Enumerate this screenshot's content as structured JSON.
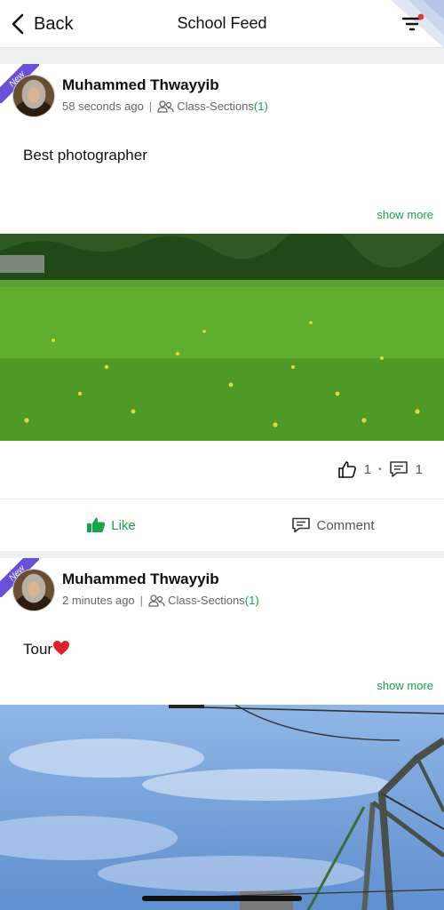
{
  "header": {
    "back_label": "Back",
    "title": "School Feed",
    "filter_icon": "filter-icon",
    "notification_dot_color": "#e53935"
  },
  "colors": {
    "accent_green": "#16a34a",
    "ribbon_purple": "#6a4fd8"
  },
  "posts": [
    {
      "badge": "New",
      "author": "Muhammed Thwayyib",
      "time": "58 seconds ago",
      "separator": "|",
      "audience_label": "Class-Sections",
      "audience_count": "(1)",
      "text": "Best photographer",
      "show_more": "show more",
      "image": "green-grass-field-photo",
      "likes": "1",
      "stat_separator": "•",
      "comments": "1",
      "like_label": "Like",
      "comment_label": "Comment"
    },
    {
      "badge": "New",
      "author": "Muhammed Thwayyib",
      "time": "2 minutes ago",
      "separator": "|",
      "audience_label": "Class-Sections",
      "audience_count": "(1)",
      "text": "Tour",
      "emoji": "red-heart",
      "show_more": "show more",
      "image": "sky-with-metal-tower-photo"
    }
  ]
}
